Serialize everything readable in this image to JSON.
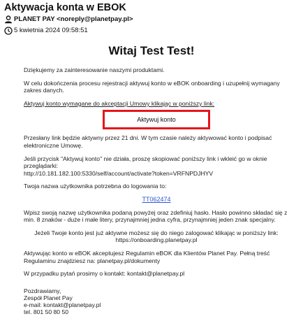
{
  "email": {
    "subject": "Aktywacja konta w EBOK",
    "from": "PLANET PAY <noreply@planetpay.pl>",
    "date": "5 kwietnia 2024 09:58:51"
  },
  "body": {
    "heading": "Witaj Test Test!",
    "p1": "Dziękujemy za zainteresowanie naszymi produktami.",
    "p2": "W celu dokończenia procesu rejestracji aktywuj konto w eBOK onboarding i uzupełnij wymagany zakres danych.",
    "p3": "Aktywuj konto wymagane do akceptacji Umowy klikając w poniższy link:",
    "button_label": "Aktywuj konto",
    "p4": "Przesłany link będzie aktywny przez 21 dni. W tym czasie należy aktywować konto i podpisać elektroniczne Umowę.",
    "p5_line1": "Jeśli przycisk \"Aktywuj konto\" nie działa, proszę skopiować poniższy link i wkleić go w oknie przeglądarki:",
    "p5_url": "http://10.181.182.100:5330/self/account/activate?token=VRFNPDJHYV",
    "p6": "Twoja nazwa użytkownika potrzebna do logowania to:",
    "username": "TT062474",
    "p7": "Wpisz swoją nazwę użytkownika podaną powyżej oraz zdefiniuj hasło. Hasło powinno składać się z min. 8 znaków - duże i małe litery, przynajmniej jedna cyfra, przynajmniej jeden znak specjalny.",
    "p8_line1": "Jeżeli Twoje konto jest już aktywne możesz się do niego zalogować klikając w poniższy link:",
    "p8_link": "https://onboarding.planetpay.pl",
    "p9": "Aktywując konto w eBOK akceptujesz Regulamin eBOK dla Klientów Planet Pay. Pełną treść Regulaminu znajdziesz na: planetpay.pl/dokumenty",
    "p10": "W przypadku pytań prosimy o kontakt: kontakt@planetpay.pl",
    "sig1": "Pozdrawiamy,",
    "sig2": "Zespół Planet Pay",
    "sig3": "e-mail: kontakt@planetpay.pl",
    "sig4": "tel. 801 50 80 50"
  }
}
